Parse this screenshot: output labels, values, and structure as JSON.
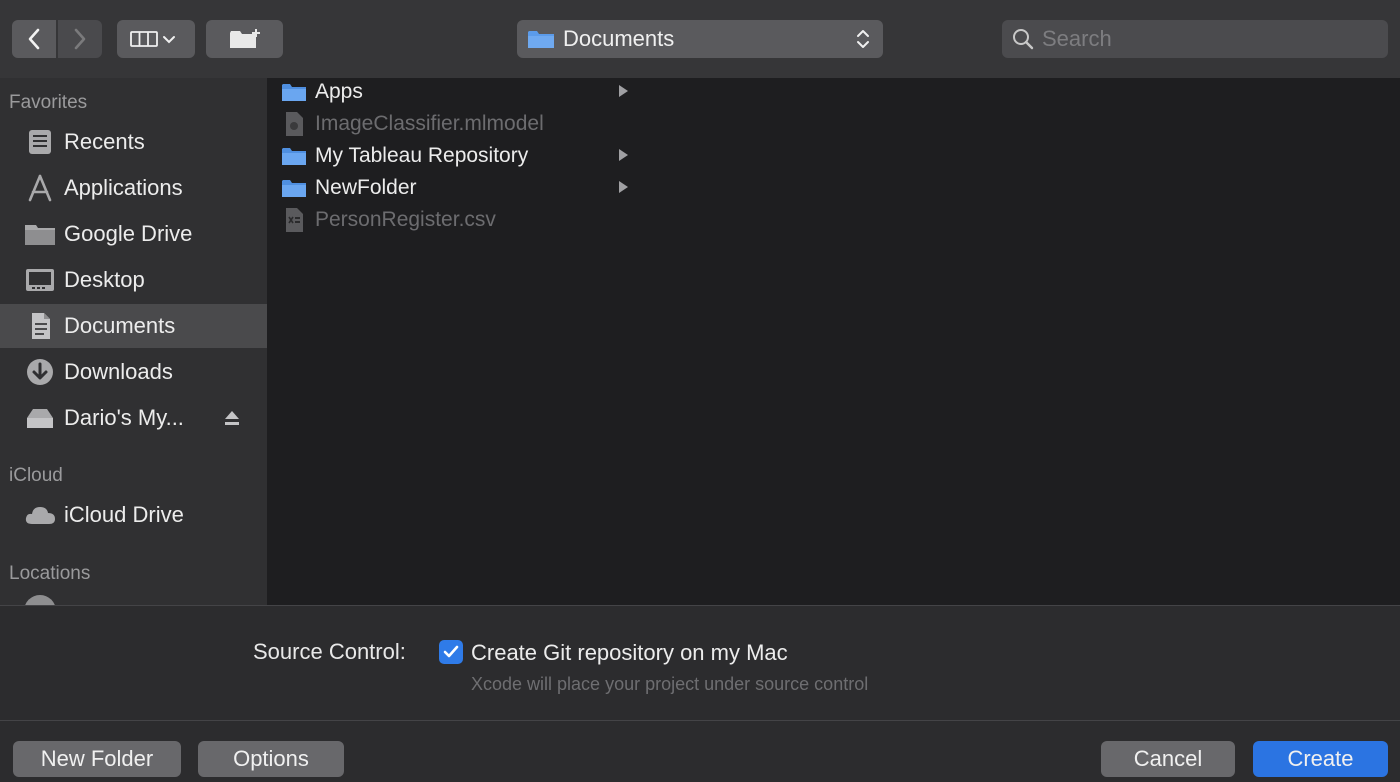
{
  "toolbar": {
    "path_label": "Documents",
    "search_placeholder": "Search"
  },
  "sidebar": {
    "favorites_title": "Favorites",
    "favorites": [
      {
        "label": "Recents",
        "icon": "recents-icon"
      },
      {
        "label": "Applications",
        "icon": "applications-icon"
      },
      {
        "label": "Google Drive",
        "icon": "folder-icon"
      },
      {
        "label": "Desktop",
        "icon": "desktop-icon"
      },
      {
        "label": "Documents",
        "icon": "document-icon",
        "selected": true
      },
      {
        "label": "Downloads",
        "icon": "download-icon"
      },
      {
        "label": "Dario's My...",
        "icon": "disk-icon",
        "eject": true
      }
    ],
    "icloud_title": "iCloud",
    "icloud": [
      {
        "label": "iCloud Drive",
        "icon": "cloud-icon"
      }
    ],
    "locations_title": "Locations"
  },
  "files": [
    {
      "name": "Apps",
      "type": "folder",
      "enabled": true
    },
    {
      "name": "ImageClassifier.mlmodel",
      "type": "file",
      "enabled": false
    },
    {
      "name": "My Tableau Repository",
      "type": "folder",
      "enabled": true
    },
    {
      "name": "NewFolder",
      "type": "folder",
      "enabled": true
    },
    {
      "name": "PersonRegister.csv",
      "type": "csv",
      "enabled": false
    }
  ],
  "options": {
    "source_control_label": "Source Control:",
    "git_checkbox_label": "Create Git repository on my Mac",
    "git_checkbox_checked": true,
    "git_hint": "Xcode will place your project under source control"
  },
  "footer": {
    "new_folder": "New Folder",
    "options": "Options",
    "cancel": "Cancel",
    "create": "Create"
  },
  "colors": {
    "accent": "#2b74e2",
    "folder": "#5b9bea"
  }
}
